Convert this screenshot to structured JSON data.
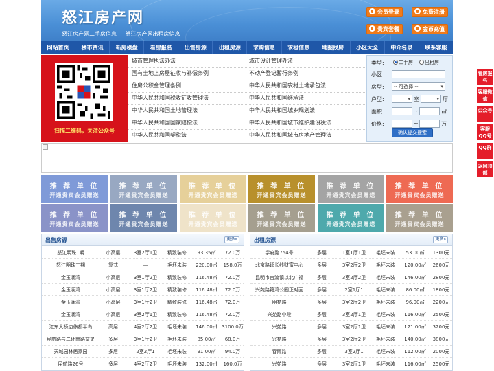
{
  "header": {
    "logo": "怒江房产网",
    "subtitle_links": [
      "怒江房产网二手房信息",
      "怒江房产网出租房信息"
    ],
    "buttons": {
      "member_login": "会员登录",
      "free_register": "免费注册",
      "vip_package": "贵宾套餐",
      "gold_recharge": "金币充值"
    }
  },
  "nav": [
    "网站首页",
    "楼市资讯",
    "新房楼盘",
    "看房报名",
    "出售房源",
    "出租房源",
    "求购信息",
    "求租信息",
    "地图找房",
    "小区大全",
    "中介名录",
    "联系客服"
  ],
  "qr": {
    "caption": "扫描二维码，关注公众号"
  },
  "laws": {
    "left": [
      "城市管理执法办法",
      "国有土地上房屋征收与补偿条例",
      "住房公积金管理条例",
      "中华人民共和国税收征收管理法",
      "中华人民共和国土地管理法",
      "中华人民共和国国家赔偿法",
      "中华人民共和国契税法"
    ],
    "right": [
      "城市设计管理办法",
      "不动产登记暂行条例",
      "中华人民共和国农村土地承包法",
      "中华人民共和国继承法",
      "中华人民共和国城乡规划法",
      "中华人民共和国城市维护建设税法",
      "中华人民共和国城市房地产管理法"
    ]
  },
  "search": {
    "type_label": "类型:",
    "type_options": [
      "二手房",
      "出租房"
    ],
    "community_label": "小区:",
    "house_type_label": "房型:",
    "house_type_value": "-- 可选择 --",
    "layout_label": "户型:",
    "room_unit": "室",
    "hall_unit": "厅",
    "area_label": "面积:",
    "area_unit": "㎡",
    "price_label": "价格:",
    "price_unit": "万",
    "range_sep": "~",
    "submit": "确认提交搜索"
  },
  "ads": {
    "title": "推 荐 单 位",
    "subtitle": "开通贵宾会员赠送",
    "colors": [
      "#7f9ad8",
      "#98a8c2",
      "#e6d09a",
      "#b8902c",
      "#a4a4a4",
      "#ee6a53",
      "#8a93c8",
      "#6e86ad",
      "#efe3c9",
      "#a59f8f",
      "#4ea9ac",
      "#a9a08f"
    ]
  },
  "sale": {
    "title": "出售房源",
    "more": "更多»",
    "rows": [
      [
        "怒江明珠1期",
        "小高层",
        "3室2厅1卫",
        "精致装修",
        "93.35㎡",
        "72.0万"
      ],
      [
        "怒江明珠三期",
        "复式",
        "—",
        "毛坯未装",
        "220.00㎡",
        "158.0万"
      ],
      [
        "金玉澜湾",
        "小高层",
        "3室1厅2卫",
        "精致装修",
        "116.48㎡",
        "72.0万"
      ],
      [
        "金玉澜湾",
        "小高层",
        "3室1厅2卫",
        "精致装修",
        "116.48㎡",
        "72.0万"
      ],
      [
        "金玉澜湾",
        "小高层",
        "3室1厅2卫",
        "精致装修",
        "116.48㎡",
        "72.0万"
      ],
      [
        "金玉澜湾",
        "小高层",
        "3室2厅1卫",
        "精致装修",
        "116.48㎡",
        "72.0万"
      ],
      [
        "江东大桥边傣都半岛",
        "高层",
        "4室2厅2卫",
        "毛坯未装",
        "146.00㎡",
        "3100.0万"
      ],
      [
        "民航路与二环南路交叉",
        "多层",
        "3室1厅2卫",
        "毛坯未装",
        "85.00㎡",
        "68.0万"
      ],
      [
        "天城园林居家园",
        "多层",
        "2室2厅1",
        "毛坯未装",
        "91.00㎡",
        "94.0万"
      ],
      [
        "民航路26号",
        "多层",
        "4室2厅2卫",
        "毛坯未装",
        "132.00㎡",
        "160.0万"
      ]
    ]
  },
  "rent": {
    "title": "出租房源",
    "more": "更多»",
    "rows": [
      [
        "学府路754号",
        "多层",
        "1室1厅1卫",
        "毛坯未装",
        "53.00㎡",
        "1300元"
      ],
      [
        "北京路延长线财富中心",
        "多层",
        "3室2厅2卫",
        "毛坯未装",
        "120.00㎡",
        "2600元"
      ],
      [
        "昆明市官渡镇以北广福",
        "多层",
        "3室2厅2卫",
        "毛坯未装",
        "146.00㎡",
        "2800元"
      ],
      [
        "兴苑路籍湾公园正对面",
        "多层",
        "2室1厅1",
        "毛坯未装",
        "86.00㎡",
        "1800元"
      ],
      [
        "朋苑路",
        "多层",
        "3室2厅2卫",
        "毛坯未装",
        "96.00㎡",
        "2200元"
      ],
      [
        "兴苑路中段",
        "多层",
        "3室2厅1卫",
        "毛坯未装",
        "116.00㎡",
        "2500元"
      ],
      [
        "兴苑路",
        "多层",
        "3室2厅1卫",
        "毛坯未装",
        "121.00㎡",
        "3200元"
      ],
      [
        "兴苑路",
        "多层",
        "3室2厅2卫",
        "毛坯未装",
        "140.00㎡",
        "3800元"
      ],
      [
        "春雨路",
        "多层",
        "3室2厅1",
        "毛坯未装",
        "112.00㎡",
        "2000元"
      ],
      [
        "兴苑路",
        "多层",
        "3室2厅1卫",
        "毛坯未装",
        "116.00㎡",
        "2500元"
      ]
    ]
  },
  "float": [
    "看房报名",
    "客服微信",
    "公众号",
    "客服QQ号",
    "QQ群",
    "返回顶部"
  ]
}
